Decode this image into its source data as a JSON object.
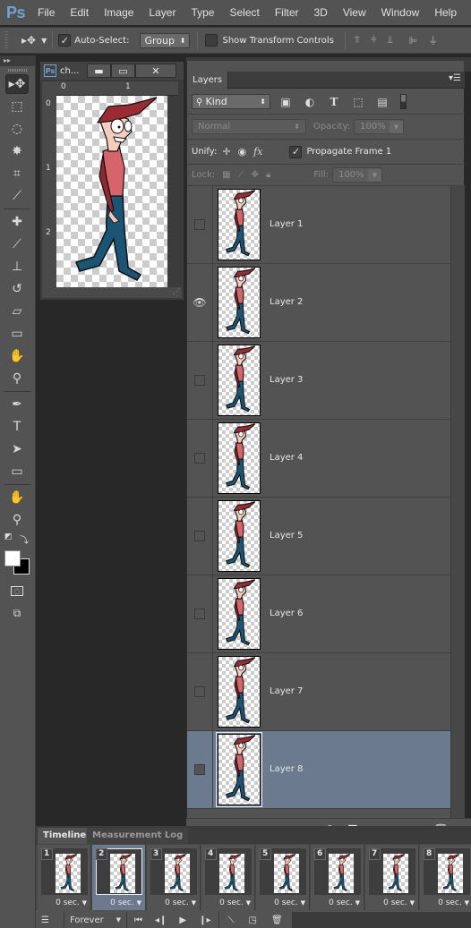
{
  "app": {
    "logo": "Ps",
    "brand_color": "#6fa3d6"
  },
  "menu": [
    "File",
    "Edit",
    "Image",
    "Layer",
    "Type",
    "Select",
    "Filter",
    "3D",
    "View",
    "Window",
    "Help"
  ],
  "options": {
    "auto_select_label": "Auto-Select:",
    "auto_select_checked": true,
    "auto_select_target": "Group",
    "show_transform_label": "Show Transform Controls",
    "show_transform_checked": false,
    "align_icons": [
      "align-top-icon",
      "align-vcenter-icon",
      "align-bottom-icon",
      "align-left-icon",
      "align-hcenter-icon"
    ]
  },
  "tools": [
    {
      "name": "move-tool",
      "glyph": "▸✥",
      "active": true
    },
    {
      "name": "marquee-tool",
      "glyph": "⬚"
    },
    {
      "name": "lasso-tool",
      "glyph": "◌"
    },
    {
      "name": "magic-wand-tool",
      "glyph": "✸"
    },
    {
      "name": "crop-tool",
      "glyph": "⌗"
    },
    {
      "name": "eyedropper-tool",
      "glyph": "⟋"
    },
    {
      "sep": true
    },
    {
      "name": "healing-brush-tool",
      "glyph": "✚"
    },
    {
      "name": "brush-tool",
      "glyph": "⟋"
    },
    {
      "name": "clone-stamp-tool",
      "glyph": "⊥"
    },
    {
      "name": "history-brush-tool",
      "glyph": "↺"
    },
    {
      "name": "eraser-tool",
      "glyph": "▱"
    },
    {
      "name": "gradient-tool",
      "glyph": "▭"
    },
    {
      "name": "blur-tool",
      "glyph": "✋"
    },
    {
      "name": "dodge-tool",
      "glyph": "⚲"
    },
    {
      "sep": true
    },
    {
      "name": "pen-tool",
      "glyph": "✒"
    },
    {
      "name": "type-tool",
      "glyph": "T"
    },
    {
      "name": "path-selection-tool",
      "glyph": "➤"
    },
    {
      "name": "rectangle-tool",
      "glyph": "▭"
    },
    {
      "sep": true
    },
    {
      "name": "hand-tool",
      "glyph": "✋"
    },
    {
      "name": "zoom-tool",
      "glyph": "⚲"
    }
  ],
  "colors": {
    "foreground": "#ffffff",
    "background": "#000000"
  },
  "document": {
    "title": "ch...",
    "ruler_h": [
      "0",
      "1"
    ],
    "ruler_v": [
      "0",
      "1",
      "2"
    ]
  },
  "layers_panel": {
    "tab": "Layers",
    "filter_kind": "Kind",
    "blend_mode": "Normal",
    "opacity_label": "Opacity:",
    "opacity_value": "100%",
    "unify_label": "Unify:",
    "propagate_label": "Propagate Frame 1",
    "propagate_checked": true,
    "lock_label": "Lock:",
    "fill_label": "Fill:",
    "fill_value": "100%",
    "layers": [
      {
        "name": "Layer 1",
        "visible": false,
        "selected": false
      },
      {
        "name": "Layer 2",
        "visible": true,
        "selected": false
      },
      {
        "name": "Layer 3",
        "visible": false,
        "selected": false
      },
      {
        "name": "Layer 4",
        "visible": false,
        "selected": false
      },
      {
        "name": "Layer 5",
        "visible": false,
        "selected": false
      },
      {
        "name": "Layer 6",
        "visible": false,
        "selected": false
      },
      {
        "name": "Layer 7",
        "visible": false,
        "selected": false
      },
      {
        "name": "Layer 8",
        "visible": false,
        "selected": true
      }
    ],
    "footer_icons": [
      "link-layers-icon",
      "fx-icon",
      "layer-mask-icon",
      "adjustment-layer-icon",
      "new-group-icon",
      "new-layer-icon",
      "delete-layer-icon"
    ]
  },
  "timeline": {
    "tabs": [
      "Timeline",
      "Measurement Log"
    ],
    "active_tab": 0,
    "frames": [
      {
        "num": "1",
        "delay": "0 sec.",
        "selected": false
      },
      {
        "num": "2",
        "delay": "0 sec.",
        "selected": true
      },
      {
        "num": "3",
        "delay": "0 sec.",
        "selected": false
      },
      {
        "num": "4",
        "delay": "0 sec.",
        "selected": false
      },
      {
        "num": "5",
        "delay": "0 sec.",
        "selected": false
      },
      {
        "num": "6",
        "delay": "0 sec.",
        "selected": false
      },
      {
        "num": "7",
        "delay": "0 sec.",
        "selected": false
      },
      {
        "num": "8",
        "delay": "0 sec.",
        "selected": false
      }
    ],
    "loop": "Forever"
  }
}
